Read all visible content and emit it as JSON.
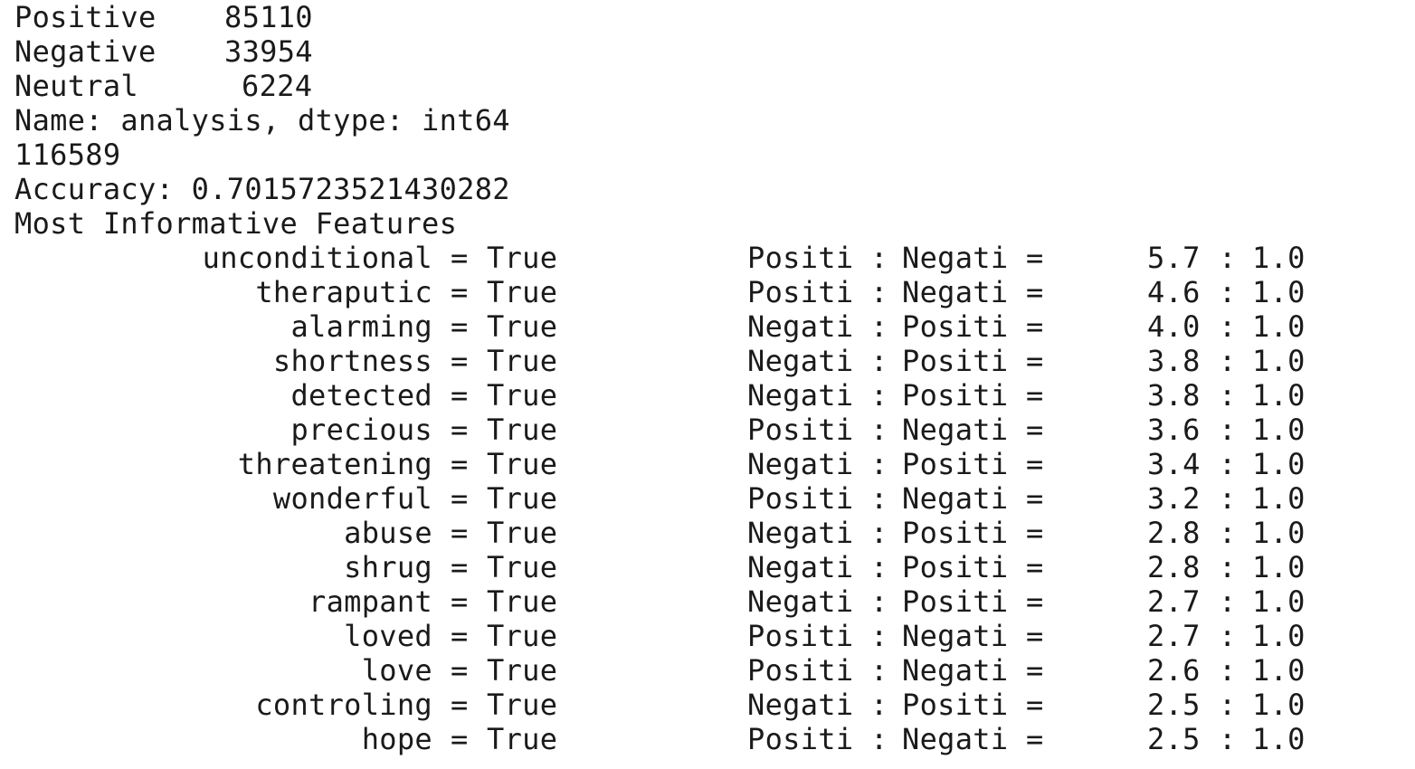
{
  "counts": [
    {
      "label": "Positive",
      "value": "85110"
    },
    {
      "label": "Negative",
      "value": "33954"
    },
    {
      "label": "Neutral",
      "value": "6224"
    }
  ],
  "name_line": "Name: analysis, dtype: int64",
  "total": "116589",
  "accuracy_line": "Accuracy: 0.7015723521430282",
  "features_title": "Most Informative Features",
  "features": [
    {
      "name": "unconditional",
      "value": "True",
      "label_a": "Positi",
      "label_b": "Negati",
      "ratio": "5.7",
      "ratio_b": "1.0"
    },
    {
      "name": "theraputic",
      "value": "True",
      "label_a": "Positi",
      "label_b": "Negati",
      "ratio": "4.6",
      "ratio_b": "1.0"
    },
    {
      "name": "alarming",
      "value": "True",
      "label_a": "Negati",
      "label_b": "Positi",
      "ratio": "4.0",
      "ratio_b": "1.0"
    },
    {
      "name": "shortness",
      "value": "True",
      "label_a": "Negati",
      "label_b": "Positi",
      "ratio": "3.8",
      "ratio_b": "1.0"
    },
    {
      "name": "detected",
      "value": "True",
      "label_a": "Negati",
      "label_b": "Positi",
      "ratio": "3.8",
      "ratio_b": "1.0"
    },
    {
      "name": "precious",
      "value": "True",
      "label_a": "Positi",
      "label_b": "Negati",
      "ratio": "3.6",
      "ratio_b": "1.0"
    },
    {
      "name": "threatening",
      "value": "True",
      "label_a": "Negati",
      "label_b": "Positi",
      "ratio": "3.4",
      "ratio_b": "1.0"
    },
    {
      "name": "wonderful",
      "value": "True",
      "label_a": "Positi",
      "label_b": "Negati",
      "ratio": "3.2",
      "ratio_b": "1.0"
    },
    {
      "name": "abuse",
      "value": "True",
      "label_a": "Negati",
      "label_b": "Positi",
      "ratio": "2.8",
      "ratio_b": "1.0"
    },
    {
      "name": "shrug",
      "value": "True",
      "label_a": "Negati",
      "label_b": "Positi",
      "ratio": "2.8",
      "ratio_b": "1.0"
    },
    {
      "name": "rampant",
      "value": "True",
      "label_a": "Negati",
      "label_b": "Positi",
      "ratio": "2.7",
      "ratio_b": "1.0"
    },
    {
      "name": "loved",
      "value": "True",
      "label_a": "Positi",
      "label_b": "Negati",
      "ratio": "2.7",
      "ratio_b": "1.0"
    },
    {
      "name": "love",
      "value": "True",
      "label_a": "Positi",
      "label_b": "Negati",
      "ratio": "2.6",
      "ratio_b": "1.0"
    },
    {
      "name": "controling",
      "value": "True",
      "label_a": "Negati",
      "label_b": "Positi",
      "ratio": "2.5",
      "ratio_b": "1.0"
    },
    {
      "name": "hope",
      "value": "True",
      "label_a": "Positi",
      "label_b": "Negati",
      "ratio": "2.5",
      "ratio_b": "1.0"
    }
  ]
}
